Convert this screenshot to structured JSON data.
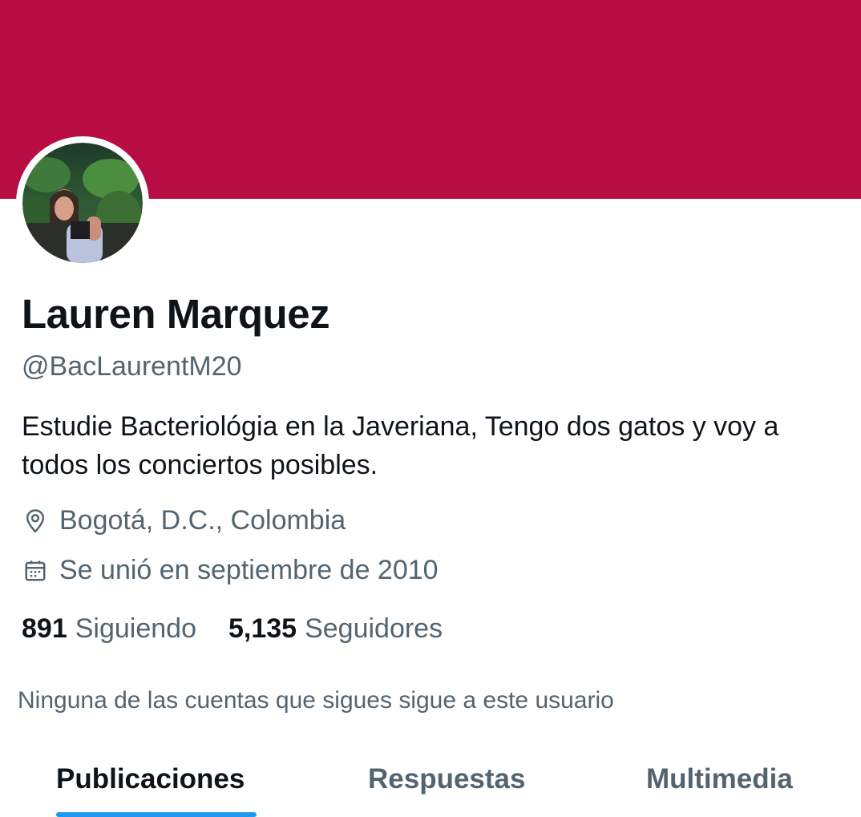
{
  "profile": {
    "banner_color": "#b70d42",
    "avatar_alt": "profile-photo",
    "name": "Lauren Marquez",
    "handle": "@BacLaurentM20",
    "bio": "Estudie Bacteriológia en la Javeriana, Tengo dos gatos y voy a todos los conciertos posibles.",
    "location_icon": "location-pin-icon",
    "location": "Bogotá, D.C., Colombia",
    "joined_icon": "calendar-icon",
    "joined": "Se unió en septiembre de 2010"
  },
  "stats": {
    "following_count": "891",
    "following_label": "Siguiendo",
    "followers_count": "5,135",
    "followers_label": "Seguidores"
  },
  "followers_you_know": "Ninguna de las cuentas que sigues sigue a este usuario",
  "tabs": [
    {
      "label": "Publicaciones",
      "active": true
    },
    {
      "label": "Respuestas",
      "active": false
    },
    {
      "label": "Multimedia",
      "active": false
    }
  ],
  "colors": {
    "accent": "#1d9bf0",
    "secondary_text": "#536471",
    "primary_text": "#0f1419"
  }
}
